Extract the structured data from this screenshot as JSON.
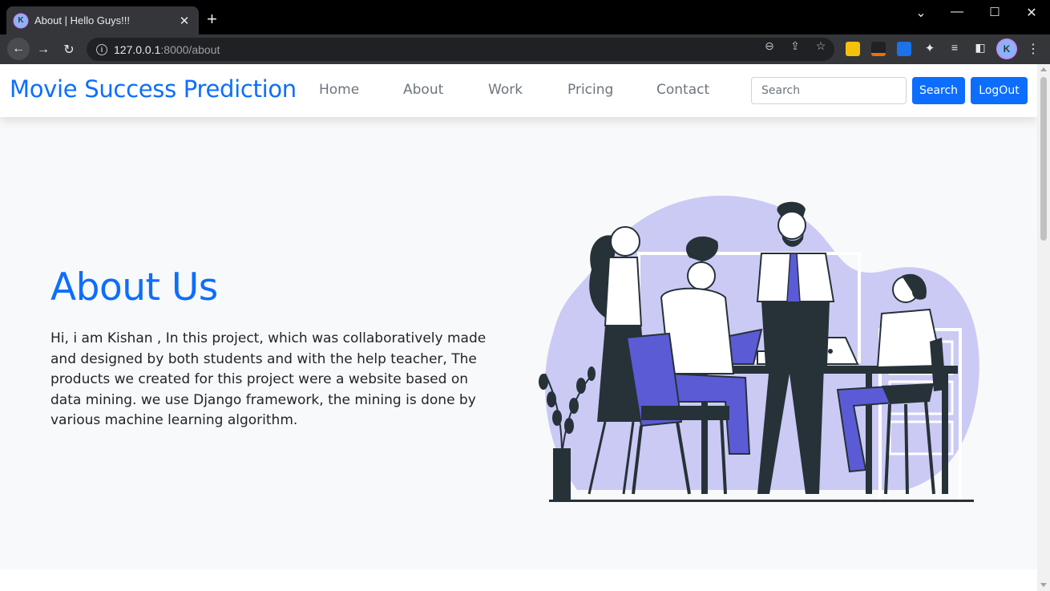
{
  "browser": {
    "tab_title": "About | Hello Guys!!!",
    "favicon_letter": "K",
    "url_host": "127.0.0.1",
    "url_path": ":8000/about",
    "profile_letter": "K"
  },
  "navbar": {
    "brand": "Movie Success Prediction",
    "links": [
      "Home",
      "About",
      "Work",
      "Pricing",
      "Contact"
    ],
    "search_placeholder": "Search",
    "search_button": "Search",
    "logout_button": "LogOut"
  },
  "hero": {
    "title": "About Us",
    "text": "Hi, i am Kishan , In this project, which was collaboratively made and designed by both students and with the help teacher, The products we created for this project were a website based on data mining. we use Django framework, the mining is done by various machine learning algorithm."
  },
  "colors": {
    "primary": "#0d6efd",
    "hero_bg": "#f8f9fa",
    "illustration_accent": "#5b5bd6",
    "illustration_blob": "#cbcaf5",
    "illustration_dark": "#263238"
  }
}
